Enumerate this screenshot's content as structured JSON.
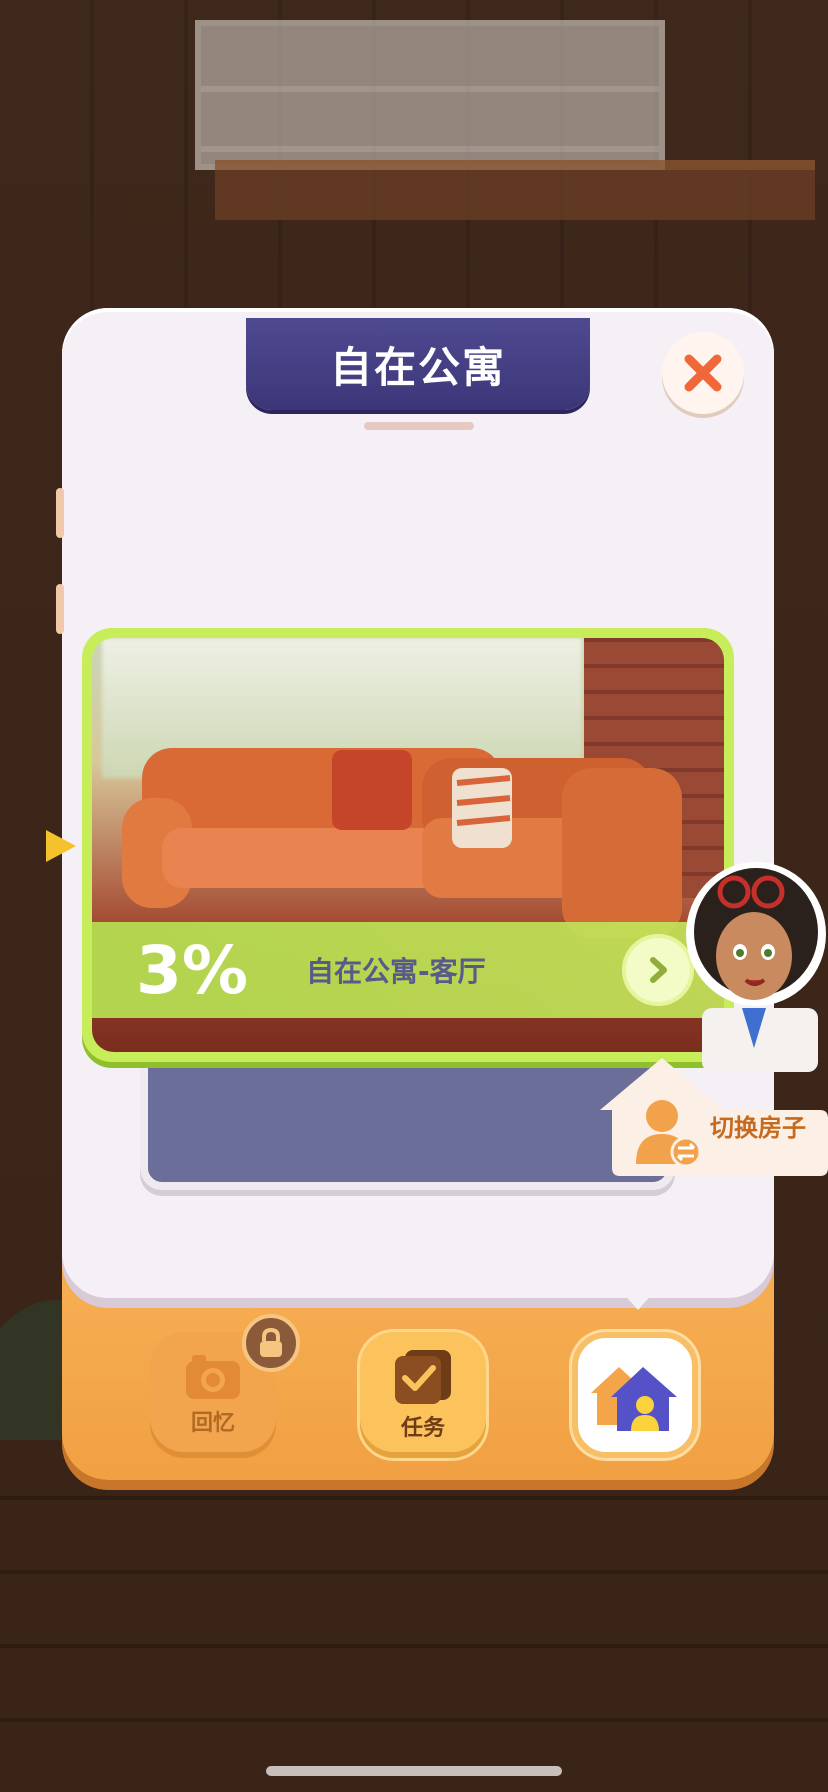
{
  "panel": {
    "title": "自在公寓"
  },
  "room_card": {
    "progress": "3%",
    "progress_value": 0.03,
    "name": "自在公寓-客厅"
  },
  "switch_house": {
    "label": "切换房子"
  },
  "tabs": [
    {
      "label": "回忆",
      "locked": true,
      "icon": "camera-icon"
    },
    {
      "label": "任务",
      "locked": false,
      "icon": "checklist-icon"
    },
    {
      "label": "",
      "locked": false,
      "icon": "house-icon",
      "selected": true
    }
  ],
  "colors": {
    "title_bg": "#4f4a90",
    "card_border": "#c7ee5a",
    "panel_base": "#f9b45a",
    "close_x": "#f0683a"
  }
}
